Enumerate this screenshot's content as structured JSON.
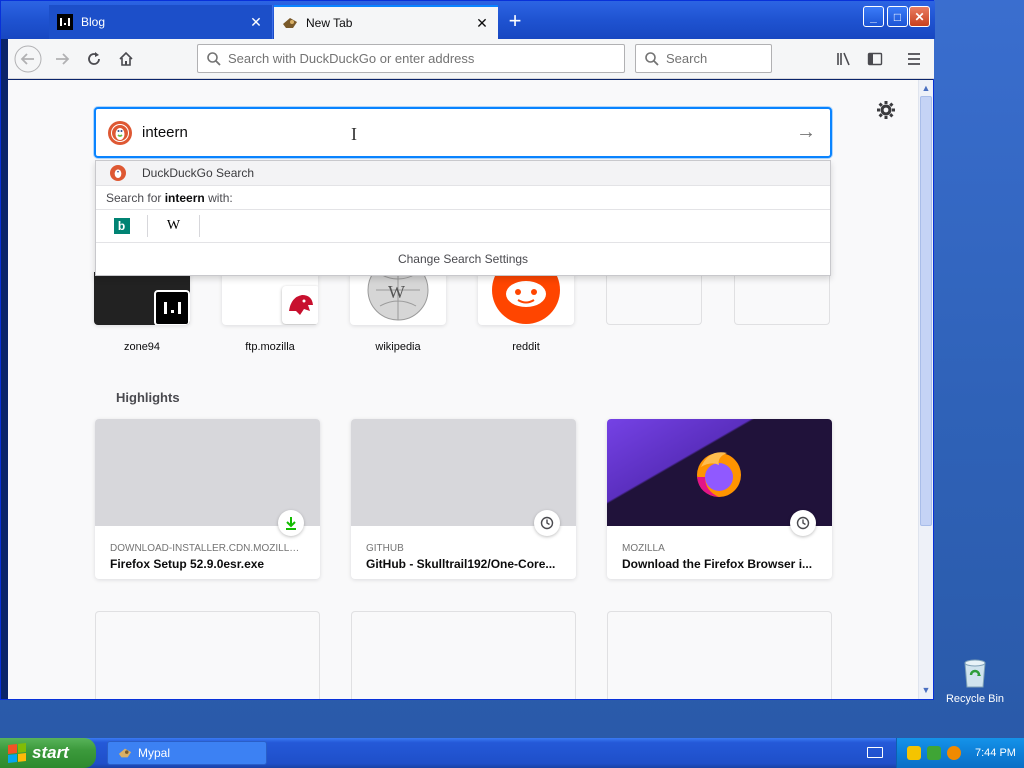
{
  "desktop": {
    "recycle_bin_label": "Recycle Bin"
  },
  "browser": {
    "tabs": [
      {
        "label": "Blog",
        "active": false
      },
      {
        "label": "New Tab",
        "active": true
      }
    ],
    "urlbar_placeholder": "Search with DuckDuckGo or enter address",
    "searchbar_placeholder": "Search"
  },
  "newtab": {
    "search_value": "inteern",
    "dropdown": {
      "engine_label": "DuckDuckGo Search",
      "search_for_prefix": "Search for",
      "search_for_term": "inteern",
      "search_for_suffix": "with:",
      "engines": [
        "bing",
        "wikipedia"
      ],
      "change_settings": "Change Search Settings"
    },
    "top_sites": [
      {
        "label": "zone94"
      },
      {
        "label": "ftp.mozilla"
      },
      {
        "label": "wikipedia"
      },
      {
        "label": "reddit"
      },
      {
        "label": ""
      },
      {
        "label": ""
      }
    ],
    "highlights_title": "Highlights",
    "highlights": [
      {
        "host": "DOWNLOAD-INSTALLER.CDN.MOZILLA ...",
        "title": "Firefox Setup 52.9.0esr.exe",
        "badge": "download-icon"
      },
      {
        "host": "GITHUB",
        "title": "GitHub - Skulltrail192/One-Core...",
        "badge": "clock-icon"
      },
      {
        "host": "MOZILLA",
        "title": "Download the Firefox Browser i...",
        "badge": "clock-icon"
      }
    ]
  },
  "taskbar": {
    "start_label": "start",
    "task_label": "Mypal",
    "clock": "7:44 PM"
  },
  "colors": {
    "accent": "#0a84ff",
    "desktop": "#2f62b8",
    "start_green": "#3c9a3c"
  }
}
